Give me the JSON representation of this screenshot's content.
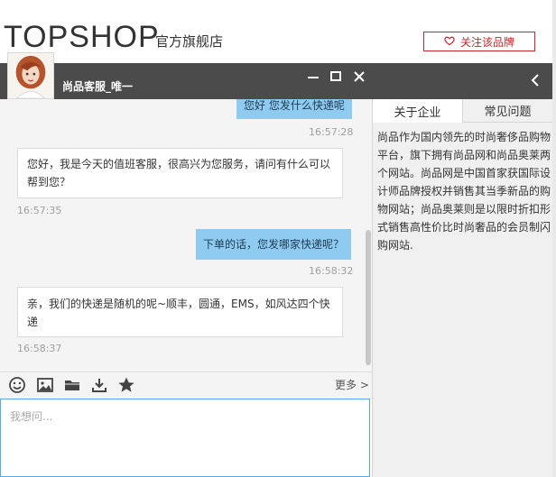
{
  "brand": {
    "logo_text": "TOPSHOP",
    "subtitle": "官方旗舰店",
    "follow_label": "关注该品牌"
  },
  "chat": {
    "agent_name": "尚品客服_唯一",
    "messages": [
      {
        "side": "right",
        "text": "您好 您发什么快递呢",
        "time": "16:57:28"
      },
      {
        "side": "left",
        "text": "您好，我是今天的值班客服，很高兴为您服务，请问有什么可以帮到您？",
        "time": "16:57:35"
      },
      {
        "side": "right",
        "text": "下单的话，您发哪家快递呢？",
        "time": "16:58:32"
      },
      {
        "side": "left",
        "text": "亲，我们的快递是随机的呢~顺丰，圆通，EMS，如风达四个快递",
        "time": "16:58:37"
      }
    ],
    "toolbar": {
      "icons": [
        "emoji-icon",
        "image-icon",
        "folder-icon",
        "download-icon",
        "star-icon"
      ],
      "more_label": "更多 >"
    },
    "input_placeholder": "我想问..."
  },
  "side_panel": {
    "tabs": [
      {
        "label": "关于企业",
        "active": true
      },
      {
        "label": "常见问题",
        "active": false
      }
    ],
    "about_text": "尚品作为国内领先的时尚奢侈品购物平台，旗下拥有尚品网和尚品奥莱两个网站。尚品网是中国首家获国际设计师品牌授权并销售其当季新品的购物网站；尚品奥莱则是以限时折扣形式销售高性价比时尚奢品的会员制闪购网站."
  },
  "colors": {
    "titlebar": "#4b4b4b",
    "bubble_right": "#8fcbf0",
    "accent_red": "#c9252b",
    "input_border": "#5aa9e6"
  }
}
